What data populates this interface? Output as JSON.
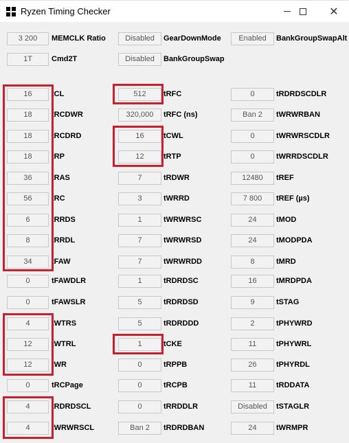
{
  "window": {
    "title": "Ryzen Timing Checker",
    "controls": {
      "minimize": "minimize-icon",
      "maximize": "maximize-icon",
      "close": "close-icon"
    }
  },
  "colors": {
    "highlight": "#c8202e",
    "background": "#f0f0f0",
    "field_border": "#c8c8c8"
  },
  "top": [
    {
      "value": "3 200",
      "label": "MEMCLK Ratio"
    },
    {
      "value": "Disabled",
      "label": "GearDownMode"
    },
    {
      "value": "Enabled",
      "label": "BankGroupSwapAlt"
    },
    {
      "value": "1T",
      "label": "Cmd2T"
    },
    {
      "value": "Disabled",
      "label": "BankGroupSwap"
    }
  ],
  "col1": [
    {
      "value": "16",
      "label": "tCL"
    },
    {
      "value": "18",
      "label": "tRCDWR"
    },
    {
      "value": "18",
      "label": "tRCDRD"
    },
    {
      "value": "18",
      "label": "tRP"
    },
    {
      "value": "36",
      "label": "tRAS"
    },
    {
      "value": "56",
      "label": "tRC"
    },
    {
      "value": "6",
      "label": "tRRDS"
    },
    {
      "value": "8",
      "label": "tRRDL"
    },
    {
      "value": "34",
      "label": "tFAW"
    },
    {
      "value": "0",
      "label": "tFAWDLR"
    },
    {
      "value": "0",
      "label": "tFAWSLR"
    },
    {
      "value": "4",
      "label": "tWTRS"
    },
    {
      "value": "12",
      "label": "tWTRL"
    },
    {
      "value": "12",
      "label": "tWR"
    },
    {
      "value": "0",
      "label": "tRCPage"
    },
    {
      "value": "4",
      "label": "tRDRDSCL"
    },
    {
      "value": "4",
      "label": "tWRWRSCL"
    }
  ],
  "col2": [
    {
      "value": "512",
      "label": "tRFC"
    },
    {
      "value": "320,000",
      "label": "tRFC (ns)"
    },
    {
      "value": "16",
      "label": "tCWL"
    },
    {
      "value": "12",
      "label": "tRTP"
    },
    {
      "value": "7",
      "label": "tRDWR"
    },
    {
      "value": "3",
      "label": "tWRRD"
    },
    {
      "value": "1",
      "label": "tWRWRSC"
    },
    {
      "value": "7",
      "label": "tWRWRSD"
    },
    {
      "value": "7",
      "label": "tWRWRDD"
    },
    {
      "value": "1",
      "label": "tRDRDSC"
    },
    {
      "value": "5",
      "label": "tRDRDSD"
    },
    {
      "value": "5",
      "label": "tRDRDDD"
    },
    {
      "value": "1",
      "label": "tCKE"
    },
    {
      "value": "0",
      "label": "tRPPB"
    },
    {
      "value": "0",
      "label": "tRCPB"
    },
    {
      "value": "0",
      "label": "tRRDDLR"
    },
    {
      "value": "Ban 2",
      "label": "tRDRDBAN"
    }
  ],
  "col3": [
    {
      "value": "0",
      "label": "tRDRDSCDLR"
    },
    {
      "value": "Ban 2",
      "label": "tWRWRBAN"
    },
    {
      "value": "0",
      "label": "tWRWRSCDLR"
    },
    {
      "value": "0",
      "label": "tWRRDSCDLR"
    },
    {
      "value": "12480",
      "label": "tREF"
    },
    {
      "value": "7 800",
      "label": "tREF (µs)"
    },
    {
      "value": "24",
      "label": "tMOD"
    },
    {
      "value": "24",
      "label": "tMODPDA"
    },
    {
      "value": "8",
      "label": "tMRD"
    },
    {
      "value": "16",
      "label": "tMRDPDA"
    },
    {
      "value": "9",
      "label": "tSTAG"
    },
    {
      "value": "2",
      "label": "tPHYWRD"
    },
    {
      "value": "11",
      "label": "tPHYWRL"
    },
    {
      "value": "26",
      "label": "tPHYRDL"
    },
    {
      "value": "11",
      "label": "tRDDATA"
    },
    {
      "value": "Disabled",
      "label": "tSTAGLR"
    },
    {
      "value": "24",
      "label": "tWRMPR"
    }
  ]
}
